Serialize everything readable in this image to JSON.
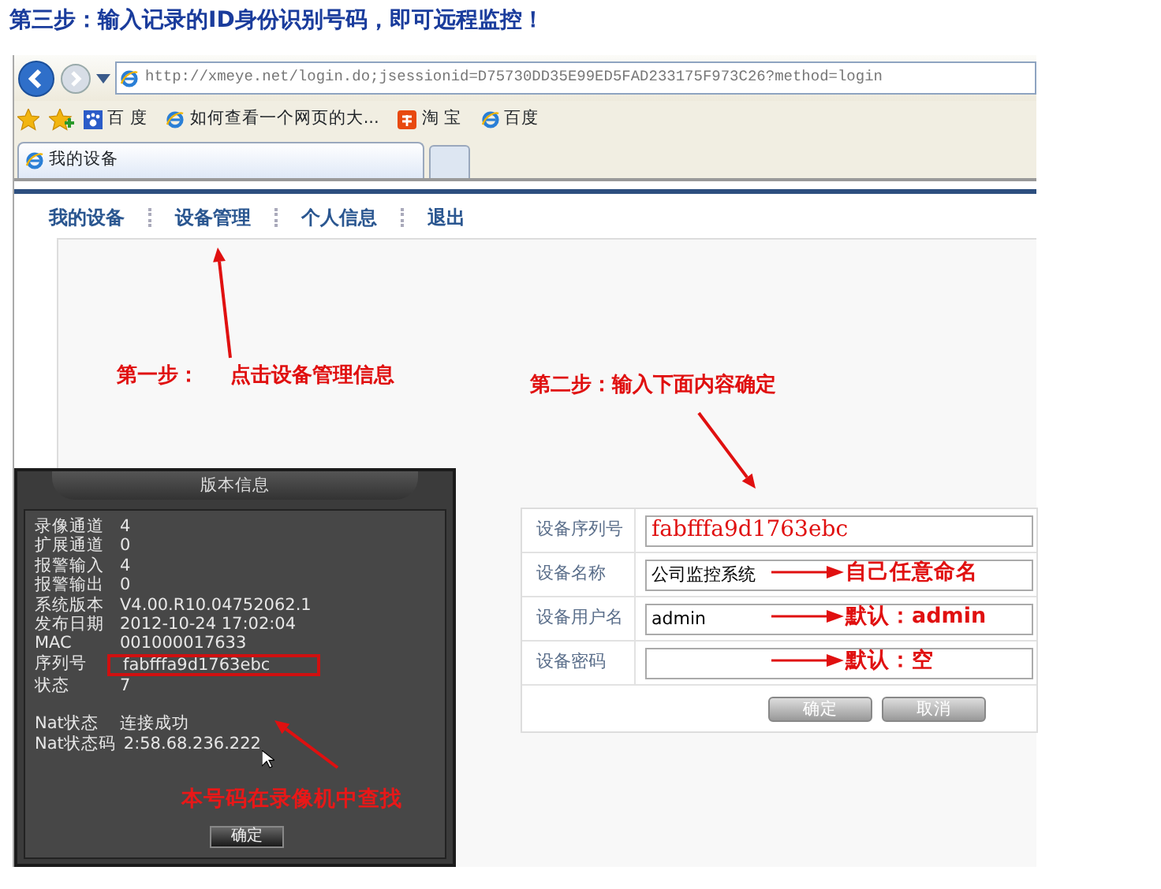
{
  "heading": "第三步：输入记录的ID身份识别号码，即可远程监控！",
  "browser": {
    "url": "http://xmeye.net/login.do;jsessionid=D75730DD35E99ED5FAD233175F973C26?method=login",
    "favorites": [
      {
        "kind": "paw",
        "label": "百 度"
      },
      {
        "kind": "ie",
        "label": "如何查看一个网页的大..."
      },
      {
        "kind": "taobao",
        "label": "淘 宝"
      },
      {
        "kind": "ie",
        "label": "百度"
      }
    ],
    "tabs": [
      {
        "label": "我的设备",
        "selected": true
      }
    ]
  },
  "site_nav": [
    {
      "label": "我的设备"
    },
    {
      "label": "设备管理"
    },
    {
      "label": "个人信息"
    },
    {
      "label": "退出"
    }
  ],
  "annotations": [
    {
      "text": "第一步："
    },
    {
      "text": "点击设备管理信息"
    },
    {
      "text": "第二步：输入下面内容确定"
    }
  ],
  "dvr_dialog": {
    "title": "版本信息",
    "groups": [
      [
        {
          "label": "录像通道",
          "value": "4",
          "highlighted": false
        },
        {
          "label": "扩展通道",
          "value": "0",
          "highlighted": false
        },
        {
          "label": "报警输入",
          "value": "4",
          "highlighted": false
        },
        {
          "label": "报警输出",
          "value": "0",
          "highlighted": false
        },
        {
          "label": "系统版本",
          "value": "V4.00.R10.04752062.1",
          "highlighted": false
        },
        {
          "label": "发布日期",
          "value": "2012-10-24 17:02:04",
          "highlighted": false
        },
        {
          "label": "MAC",
          "value": "001000017633",
          "highlighted": false
        },
        {
          "label": "序列号",
          "value": "fabfffa9d1763ebc",
          "highlighted": true
        },
        {
          "label": "状态",
          "value": "7",
          "highlighted": false
        }
      ],
      [
        {
          "label": "Nat状态",
          "value": "连接成功",
          "highlighted": false
        },
        {
          "label": "Nat状态码",
          "value": "2:58.68.236.222",
          "highlighted": false
        }
      ]
    ],
    "annotation": "本号码在录像机中查找",
    "button": "确定"
  },
  "form": {
    "fields": [
      {
        "label": "设备序列号",
        "kind": "annotated",
        "value": "fabfffa9d1763ebc"
      },
      {
        "label": "设备名称",
        "kind": "plain",
        "value": "公司监控系统",
        "note": "自己任意命名"
      },
      {
        "label": "设备用户名",
        "kind": "plain",
        "value": "admin",
        "note": "默认：admin"
      },
      {
        "label": "设备密码",
        "kind": "plain",
        "note": "默认：空"
      }
    ],
    "buttons": [
      "确定",
      "取消"
    ]
  }
}
